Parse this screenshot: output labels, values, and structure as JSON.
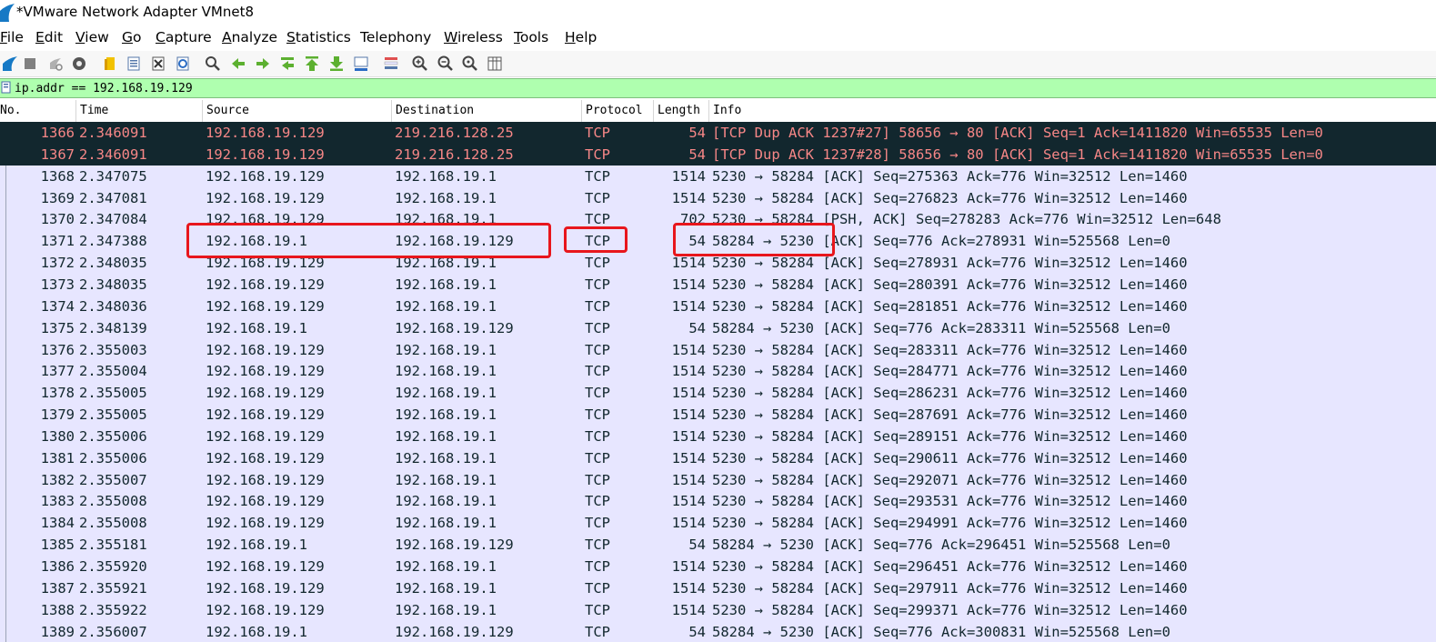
{
  "window": {
    "title": "*VMware Network Adapter VMnet8"
  },
  "menu": [
    {
      "label": "File",
      "accel": "F",
      "rest": "ile"
    },
    {
      "label": "Edit",
      "accel": "E",
      "rest": "dit"
    },
    {
      "label": "View",
      "accel": "V",
      "rest": "iew"
    },
    {
      "label": "Go",
      "accel": "G",
      "rest": "o"
    },
    {
      "label": "Capture",
      "accel": "C",
      "rest": "apture"
    },
    {
      "label": "Analyze",
      "accel": "A",
      "rest": "nalyze"
    },
    {
      "label": "Statistics",
      "accel": "S",
      "rest": "tatistics"
    },
    {
      "label": "Telephony",
      "accel": "",
      "rest": "Telephony"
    },
    {
      "label": "Wireless",
      "accel": "W",
      "rest": "ireless"
    },
    {
      "label": "Tools",
      "accel": "T",
      "rest": "ools"
    },
    {
      "label": "Help",
      "accel": "H",
      "rest": "elp"
    }
  ],
  "toolbar": [
    "shark-fin-icon",
    "stop-capture-icon",
    "restart-capture-icon",
    "capture-options-icon",
    "open-file-icon",
    "save-file-icon",
    "close-file-icon",
    "reload-file-icon",
    "find-packet-icon",
    "go-back-icon",
    "go-forward-icon",
    "go-to-packet-icon",
    "go-first-icon",
    "go-last-icon",
    "autoscroll-icon",
    "colorize-icon",
    "zoom-in-icon",
    "zoom-out-icon",
    "zoom-normal-icon",
    "resize-columns-icon"
  ],
  "filter": {
    "value": "ip.addr == 192.168.19.129",
    "bg_color": "#afffaf"
  },
  "columns": {
    "no": "No.",
    "time": "Time",
    "source": "Source",
    "destination": "Destination",
    "protocol": "Protocol",
    "length": "Length",
    "info": "Info"
  },
  "packets": [
    {
      "no": "1366",
      "time": "2.346091",
      "src": "192.168.19.129",
      "dst": "219.216.128.25",
      "proto": "TCP",
      "len": "54",
      "info": "[TCP Dup ACK 1237#27] 58656 → 80 [ACK] Seq=1 Ack=1411820 Win=65535 Len=0",
      "style": "dark"
    },
    {
      "no": "1367",
      "time": "2.346091",
      "src": "192.168.19.129",
      "dst": "219.216.128.25",
      "proto": "TCP",
      "len": "54",
      "info": "[TCP Dup ACK 1237#28] 58656 → 80 [ACK] Seq=1 Ack=1411820 Win=65535 Len=0",
      "style": "dark"
    },
    {
      "no": "1368",
      "time": "2.347075",
      "src": "192.168.19.129",
      "dst": "192.168.19.1",
      "proto": "TCP",
      "len": "1514",
      "info": "5230 → 58284 [ACK] Seq=275363 Ack=776 Win=32512 Len=1460",
      "style": "normal"
    },
    {
      "no": "1369",
      "time": "2.347081",
      "src": "192.168.19.129",
      "dst": "192.168.19.1",
      "proto": "TCP",
      "len": "1514",
      "info": "5230 → 58284 [ACK] Seq=276823 Ack=776 Win=32512 Len=1460",
      "style": "normal"
    },
    {
      "no": "1370",
      "time": "2.347084",
      "src": "192.168.19.129",
      "dst": "192.168.19.1",
      "proto": "TCP",
      "len": "702",
      "info": "5230 → 58284 [PSH, ACK] Seq=278283 Ack=776 Win=32512 Len=648",
      "style": "normal"
    },
    {
      "no": "1371",
      "time": "2.347388",
      "src": "192.168.19.1",
      "dst": "192.168.19.129",
      "proto": "TCP",
      "len": "54",
      "info": "58284 → 5230 [ACK] Seq=776 Ack=278931 Win=525568 Len=0",
      "style": "normal"
    },
    {
      "no": "1372",
      "time": "2.348035",
      "src": "192.168.19.129",
      "dst": "192.168.19.1",
      "proto": "TCP",
      "len": "1514",
      "info": "5230 → 58284 [ACK] Seq=278931 Ack=776 Win=32512 Len=1460",
      "style": "normal"
    },
    {
      "no": "1373",
      "time": "2.348035",
      "src": "192.168.19.129",
      "dst": "192.168.19.1",
      "proto": "TCP",
      "len": "1514",
      "info": "5230 → 58284 [ACK] Seq=280391 Ack=776 Win=32512 Len=1460",
      "style": "normal"
    },
    {
      "no": "1374",
      "time": "2.348036",
      "src": "192.168.19.129",
      "dst": "192.168.19.1",
      "proto": "TCP",
      "len": "1514",
      "info": "5230 → 58284 [ACK] Seq=281851 Ack=776 Win=32512 Len=1460",
      "style": "normal"
    },
    {
      "no": "1375",
      "time": "2.348139",
      "src": "192.168.19.1",
      "dst": "192.168.19.129",
      "proto": "TCP",
      "len": "54",
      "info": "58284 → 5230 [ACK] Seq=776 Ack=283311 Win=525568 Len=0",
      "style": "normal"
    },
    {
      "no": "1376",
      "time": "2.355003",
      "src": "192.168.19.129",
      "dst": "192.168.19.1",
      "proto": "TCP",
      "len": "1514",
      "info": "5230 → 58284 [ACK] Seq=283311 Ack=776 Win=32512 Len=1460",
      "style": "normal"
    },
    {
      "no": "1377",
      "time": "2.355004",
      "src": "192.168.19.129",
      "dst": "192.168.19.1",
      "proto": "TCP",
      "len": "1514",
      "info": "5230 → 58284 [ACK] Seq=284771 Ack=776 Win=32512 Len=1460",
      "style": "normal"
    },
    {
      "no": "1378",
      "time": "2.355005",
      "src": "192.168.19.129",
      "dst": "192.168.19.1",
      "proto": "TCP",
      "len": "1514",
      "info": "5230 → 58284 [ACK] Seq=286231 Ack=776 Win=32512 Len=1460",
      "style": "normal"
    },
    {
      "no": "1379",
      "time": "2.355005",
      "src": "192.168.19.129",
      "dst": "192.168.19.1",
      "proto": "TCP",
      "len": "1514",
      "info": "5230 → 58284 [ACK] Seq=287691 Ack=776 Win=32512 Len=1460",
      "style": "normal"
    },
    {
      "no": "1380",
      "time": "2.355006",
      "src": "192.168.19.129",
      "dst": "192.168.19.1",
      "proto": "TCP",
      "len": "1514",
      "info": "5230 → 58284 [ACK] Seq=289151 Ack=776 Win=32512 Len=1460",
      "style": "normal"
    },
    {
      "no": "1381",
      "time": "2.355006",
      "src": "192.168.19.129",
      "dst": "192.168.19.1",
      "proto": "TCP",
      "len": "1514",
      "info": "5230 → 58284 [ACK] Seq=290611 Ack=776 Win=32512 Len=1460",
      "style": "normal"
    },
    {
      "no": "1382",
      "time": "2.355007",
      "src": "192.168.19.129",
      "dst": "192.168.19.1",
      "proto": "TCP",
      "len": "1514",
      "info": "5230 → 58284 [ACK] Seq=292071 Ack=776 Win=32512 Len=1460",
      "style": "normal"
    },
    {
      "no": "1383",
      "time": "2.355008",
      "src": "192.168.19.129",
      "dst": "192.168.19.1",
      "proto": "TCP",
      "len": "1514",
      "info": "5230 → 58284 [ACK] Seq=293531 Ack=776 Win=32512 Len=1460",
      "style": "normal"
    },
    {
      "no": "1384",
      "time": "2.355008",
      "src": "192.168.19.129",
      "dst": "192.168.19.1",
      "proto": "TCP",
      "len": "1514",
      "info": "5230 → 58284 [ACK] Seq=294991 Ack=776 Win=32512 Len=1460",
      "style": "normal"
    },
    {
      "no": "1385",
      "time": "2.355181",
      "src": "192.168.19.1",
      "dst": "192.168.19.129",
      "proto": "TCP",
      "len": "54",
      "info": "58284 → 5230 [ACK] Seq=776 Ack=296451 Win=525568 Len=0",
      "style": "normal"
    },
    {
      "no": "1386",
      "time": "2.355920",
      "src": "192.168.19.129",
      "dst": "192.168.19.1",
      "proto": "TCP",
      "len": "1514",
      "info": "5230 → 58284 [ACK] Seq=296451 Ack=776 Win=32512 Len=1460",
      "style": "normal"
    },
    {
      "no": "1387",
      "time": "2.355921",
      "src": "192.168.19.129",
      "dst": "192.168.19.1",
      "proto": "TCP",
      "len": "1514",
      "info": "5230 → 58284 [ACK] Seq=297911 Ack=776 Win=32512 Len=1460",
      "style": "normal"
    },
    {
      "no": "1388",
      "time": "2.355922",
      "src": "192.168.19.129",
      "dst": "192.168.19.1",
      "proto": "TCP",
      "len": "1514",
      "info": "5230 → 58284 [ACK] Seq=299371 Ack=776 Win=32512 Len=1460",
      "style": "normal"
    },
    {
      "no": "1389",
      "time": "2.356007",
      "src": "192.168.19.1",
      "dst": "192.168.19.129",
      "proto": "TCP",
      "len": "54",
      "info": "58284 → 5230 [ACK] Seq=776 Ack=300831 Win=525568 Len=0",
      "style": "normal"
    }
  ],
  "colors": {
    "dark_row_bg": "#12272e",
    "dark_row_fg": "#f78787",
    "tcp_row_bg": "#e7e6ff",
    "tcp_row_fg": "#12272e",
    "annotation": "#e8161c"
  }
}
